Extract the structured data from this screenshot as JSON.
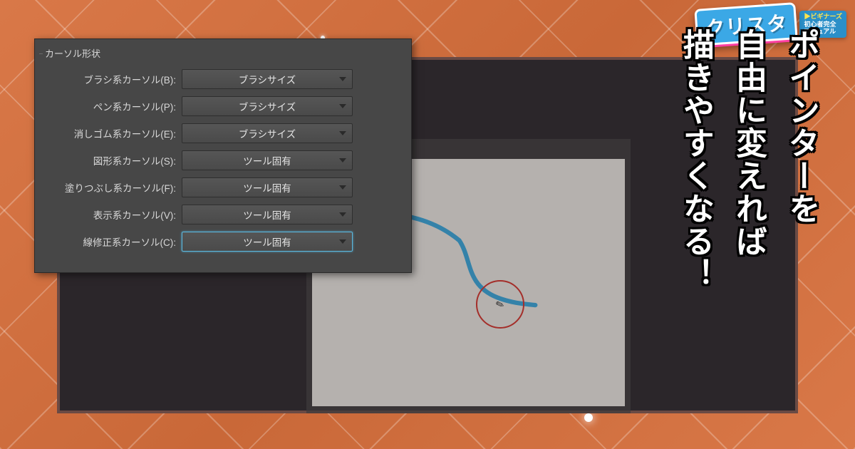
{
  "logo": {
    "main": "クリスタ",
    "beginners": "▶ビギナーズ",
    "sub1": "初心者完全",
    "sub2": "マニュアル"
  },
  "panel": {
    "legend": "カーソル形状",
    "rows": [
      {
        "label": "ブラシ系カーソル(B):",
        "value": "ブラシサイズ"
      },
      {
        "label": "ペン系カーソル(P):",
        "value": "ブラシサイズ"
      },
      {
        "label": "消しゴム系カーソル(E):",
        "value": "ブラシサイズ"
      },
      {
        "label": "図形系カーソル(S):",
        "value": "ツール固有"
      },
      {
        "label": "塗りつぶし系カーソル(F):",
        "value": "ツール固有"
      },
      {
        "label": "表示系カーソル(V):",
        "value": "ツール固有"
      },
      {
        "label": "線修正系カーソル(C):",
        "value": "ツール固有"
      }
    ],
    "highlight_index": 6
  },
  "headline": {
    "line1": "ポインターを",
    "line2": "自由に変えれば",
    "line3": "描きやすくなる！"
  }
}
